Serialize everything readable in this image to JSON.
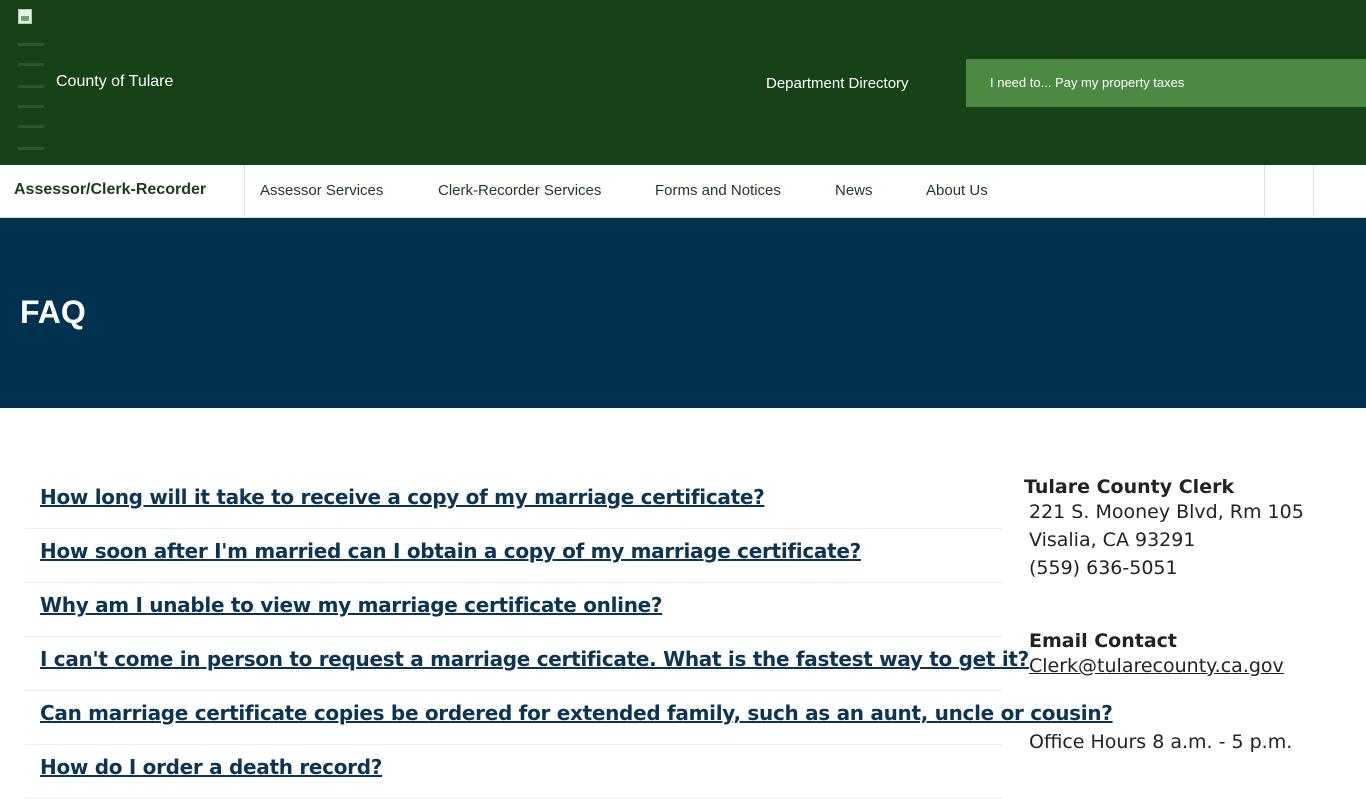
{
  "header": {
    "site_name": "County of Tulare",
    "department_directory": "Department Directory",
    "i_need_to": "I need to... Pay my property taxes"
  },
  "nav": {
    "department": "Assessor/Clerk-Recorder",
    "items": [
      {
        "label": "Assessor Services"
      },
      {
        "label": "Clerk-Recorder Services"
      },
      {
        "label": "Forms and Notices"
      },
      {
        "label": "News"
      },
      {
        "label": "About Us"
      }
    ]
  },
  "hero": {
    "title": "FAQ"
  },
  "faq": [
    {
      "question": "How long will it take to receive a copy of my marriage certificate?"
    },
    {
      "question": "How soon after I'm married can I obtain a copy of my marriage certificate?"
    },
    {
      "question": "Why am I unable to view my marriage certificate online?"
    },
    {
      "question": "I can't come in person to request a marriage certificate. What is the fastest way to get it?"
    },
    {
      "question": "Can marriage certificate copies be ordered for extended family, such as an aunt, uncle or cousin?"
    },
    {
      "question": "How do I order a death record?"
    }
  ],
  "sidebar": {
    "contact_title": "Tulare County Clerk",
    "address1": "221 S. Mooney Blvd, Rm 105",
    "address2": "Visalia, CA 93291",
    "phone": "(559) 636-5051",
    "email_title": "Email Contact",
    "email": "Clerk@tularecounty.ca.gov",
    "hours": "Office Hours 8 a.m. - 5 p.m."
  },
  "colors": {
    "header_green": "#174117",
    "accent_green": "#4c8a44",
    "hero_navy": "#00314f",
    "link_blue": "#0b3552"
  }
}
